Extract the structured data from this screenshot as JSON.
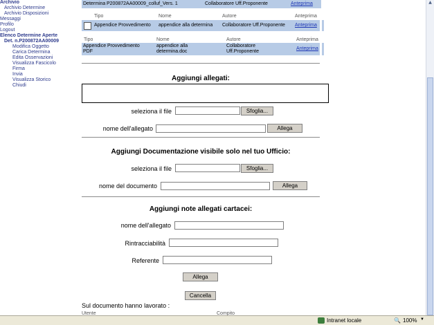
{
  "nav": {
    "items": [
      {
        "label": "Archivio",
        "level": "h"
      },
      {
        "label": "Archivio Determine",
        "level": "l1"
      },
      {
        "label": "Archivio Disposizioni",
        "level": "l1"
      },
      {
        "label": "Messaggi",
        "level": "l0"
      },
      {
        "label": "Profilo",
        "level": "l0"
      },
      {
        "label": "Logout",
        "level": "l0"
      },
      {
        "label": "Elenco Determine Aperte",
        "level": "h"
      },
      {
        "label": "Det. n.P200872AA00009",
        "level": "top"
      },
      {
        "label": "Modifica Oggetto",
        "level": "l2"
      },
      {
        "label": "Carica Determina",
        "level": "l2"
      },
      {
        "label": "Edita Osservazioni",
        "level": "l2"
      },
      {
        "label": "Visualizza Fascicolo",
        "level": "l2"
      },
      {
        "label": "Firma",
        "level": "l2"
      },
      {
        "label": "Invia",
        "level": "l2"
      },
      {
        "label": "Visualizza Storico",
        "level": "l2"
      },
      {
        "label": "Chiudi",
        "level": "l2"
      }
    ]
  },
  "table1": {
    "row": {
      "tipo": "Determina",
      "nome": "P200872AA00009_colluf_Vers. 1",
      "autore": "Collaboratore Uff.Proponente",
      "anteprima": "Anteprima"
    },
    "headers": {
      "tipo": "Tipo",
      "nome": "Nome",
      "autore": "Autore",
      "anteprima": "Anteprima"
    },
    "row2": {
      "tipo": "Appendice Provvedimento",
      "nome": "appendice alla determina",
      "autore": "Collaboratore Uff.Proponente",
      "anteprima": "Anteprima"
    }
  },
  "table2": {
    "headers": {
      "tipo": "Tipo",
      "nome": "Nome",
      "autore": "Autore",
      "anteprima": "Anteprima"
    },
    "row": {
      "tipo1": "Appendice Provvedimento",
      "tipo2": "PDF",
      "nome1": "appendice alla",
      "nome2": "determina.doc",
      "autore1": "Collaboratore",
      "autore2": "Uff.Proponente",
      "anteprima": "Anteprima"
    }
  },
  "allegati": {
    "title": "Aggiungi allegati:",
    "file_label": "seleziona il file",
    "browse": "Sfoglia...",
    "name_label": "nome dell'allegato",
    "submit": "Allega"
  },
  "docs": {
    "title": "Aggiungi Documentazione visibile solo nel tuo Ufficio:",
    "file_label": "seleziona il file",
    "browse": "Sfoglia...",
    "name_label": "nome del documento",
    "submit": "Allega"
  },
  "note": {
    "title": "Aggiungi note allegati cartacei:",
    "name_label": "nome dell'allegato",
    "trace_label": "Rintracciabilità",
    "ref_label": "Referente",
    "submit": "Allega"
  },
  "cancel": "Cancella",
  "worked": {
    "title": "Sul documento hanno lavorato :",
    "col_user": "Utente",
    "col_task": "Compito"
  },
  "status": {
    "zone": "Intranet locale",
    "zoom": "100%"
  }
}
